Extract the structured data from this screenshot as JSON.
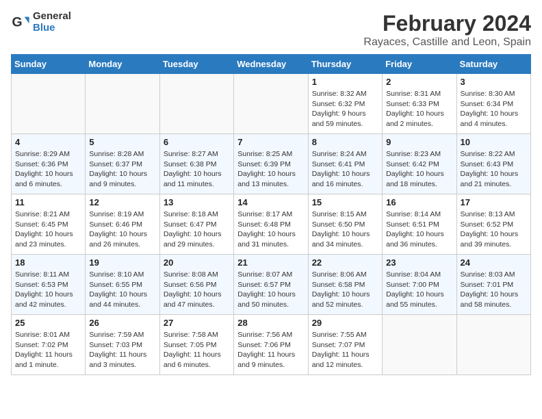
{
  "header": {
    "logo_line1": "General",
    "logo_line2": "Blue",
    "title": "February 2024",
    "subtitle": "Rayaces, Castille and Leon, Spain"
  },
  "weekdays": [
    "Sunday",
    "Monday",
    "Tuesday",
    "Wednesday",
    "Thursday",
    "Friday",
    "Saturday"
  ],
  "weeks": [
    [
      {
        "day": "",
        "empty": true
      },
      {
        "day": "",
        "empty": true
      },
      {
        "day": "",
        "empty": true
      },
      {
        "day": "",
        "empty": true
      },
      {
        "day": "1",
        "sunrise": "8:32 AM",
        "sunset": "6:32 PM",
        "daylight": "9 hours and 59 minutes."
      },
      {
        "day": "2",
        "sunrise": "8:31 AM",
        "sunset": "6:33 PM",
        "daylight": "10 hours and 2 minutes."
      },
      {
        "day": "3",
        "sunrise": "8:30 AM",
        "sunset": "6:34 PM",
        "daylight": "10 hours and 4 minutes."
      }
    ],
    [
      {
        "day": "4",
        "sunrise": "8:29 AM",
        "sunset": "6:36 PM",
        "daylight": "10 hours and 6 minutes."
      },
      {
        "day": "5",
        "sunrise": "8:28 AM",
        "sunset": "6:37 PM",
        "daylight": "10 hours and 9 minutes."
      },
      {
        "day": "6",
        "sunrise": "8:27 AM",
        "sunset": "6:38 PM",
        "daylight": "10 hours and 11 minutes."
      },
      {
        "day": "7",
        "sunrise": "8:25 AM",
        "sunset": "6:39 PM",
        "daylight": "10 hours and 13 minutes."
      },
      {
        "day": "8",
        "sunrise": "8:24 AM",
        "sunset": "6:41 PM",
        "daylight": "10 hours and 16 minutes."
      },
      {
        "day": "9",
        "sunrise": "8:23 AM",
        "sunset": "6:42 PM",
        "daylight": "10 hours and 18 minutes."
      },
      {
        "day": "10",
        "sunrise": "8:22 AM",
        "sunset": "6:43 PM",
        "daylight": "10 hours and 21 minutes."
      }
    ],
    [
      {
        "day": "11",
        "sunrise": "8:21 AM",
        "sunset": "6:45 PM",
        "daylight": "10 hours and 23 minutes."
      },
      {
        "day": "12",
        "sunrise": "8:19 AM",
        "sunset": "6:46 PM",
        "daylight": "10 hours and 26 minutes."
      },
      {
        "day": "13",
        "sunrise": "8:18 AM",
        "sunset": "6:47 PM",
        "daylight": "10 hours and 29 minutes."
      },
      {
        "day": "14",
        "sunrise": "8:17 AM",
        "sunset": "6:48 PM",
        "daylight": "10 hours and 31 minutes."
      },
      {
        "day": "15",
        "sunrise": "8:15 AM",
        "sunset": "6:50 PM",
        "daylight": "10 hours and 34 minutes."
      },
      {
        "day": "16",
        "sunrise": "8:14 AM",
        "sunset": "6:51 PM",
        "daylight": "10 hours and 36 minutes."
      },
      {
        "day": "17",
        "sunrise": "8:13 AM",
        "sunset": "6:52 PM",
        "daylight": "10 hours and 39 minutes."
      }
    ],
    [
      {
        "day": "18",
        "sunrise": "8:11 AM",
        "sunset": "6:53 PM",
        "daylight": "10 hours and 42 minutes."
      },
      {
        "day": "19",
        "sunrise": "8:10 AM",
        "sunset": "6:55 PM",
        "daylight": "10 hours and 44 minutes."
      },
      {
        "day": "20",
        "sunrise": "8:08 AM",
        "sunset": "6:56 PM",
        "daylight": "10 hours and 47 minutes."
      },
      {
        "day": "21",
        "sunrise": "8:07 AM",
        "sunset": "6:57 PM",
        "daylight": "10 hours and 50 minutes."
      },
      {
        "day": "22",
        "sunrise": "8:06 AM",
        "sunset": "6:58 PM",
        "daylight": "10 hours and 52 minutes."
      },
      {
        "day": "23",
        "sunrise": "8:04 AM",
        "sunset": "7:00 PM",
        "daylight": "10 hours and 55 minutes."
      },
      {
        "day": "24",
        "sunrise": "8:03 AM",
        "sunset": "7:01 PM",
        "daylight": "10 hours and 58 minutes."
      }
    ],
    [
      {
        "day": "25",
        "sunrise": "8:01 AM",
        "sunset": "7:02 PM",
        "daylight": "11 hours and 1 minute."
      },
      {
        "day": "26",
        "sunrise": "7:59 AM",
        "sunset": "7:03 PM",
        "daylight": "11 hours and 3 minutes."
      },
      {
        "day": "27",
        "sunrise": "7:58 AM",
        "sunset": "7:05 PM",
        "daylight": "11 hours and 6 minutes."
      },
      {
        "day": "28",
        "sunrise": "7:56 AM",
        "sunset": "7:06 PM",
        "daylight": "11 hours and 9 minutes."
      },
      {
        "day": "29",
        "sunrise": "7:55 AM",
        "sunset": "7:07 PM",
        "daylight": "11 hours and 12 minutes."
      },
      {
        "day": "",
        "empty": true
      },
      {
        "day": "",
        "empty": true
      }
    ]
  ],
  "labels": {
    "sunrise": "Sunrise:",
    "sunset": "Sunset:",
    "daylight": "Daylight:"
  }
}
